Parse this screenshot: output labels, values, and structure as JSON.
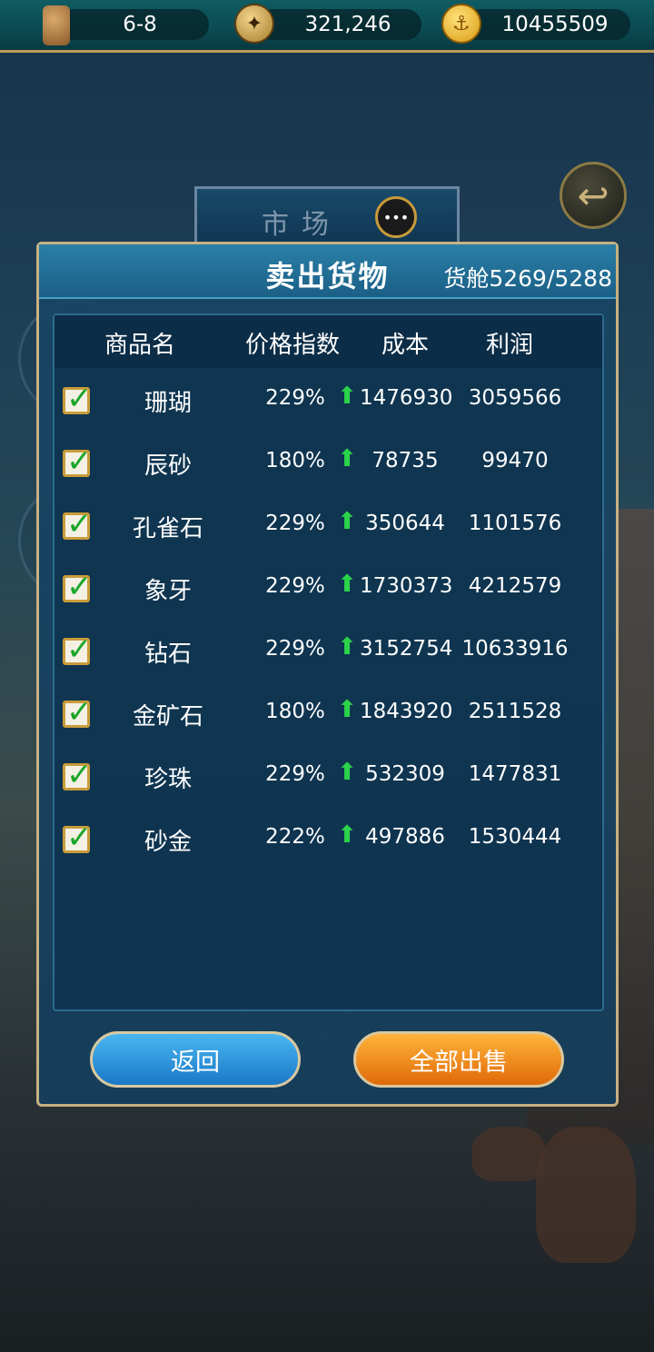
{
  "topbar": {
    "date": "6-8",
    "compass_value": "321,246",
    "gold": "10455509"
  },
  "market_tab": {
    "label": "市场"
  },
  "dialog": {
    "title": "卖出货物",
    "cargo": "货舱5269/5288",
    "columns": [
      "商品名",
      "价格指数",
      "成本",
      "利润"
    ],
    "rows": [
      {
        "name": "珊瑚",
        "pct": "229%",
        "cost": "1476930",
        "profit": "3059566",
        "checked": true
      },
      {
        "name": "辰砂",
        "pct": "180%",
        "cost": "78735",
        "profit": "99470",
        "checked": true
      },
      {
        "name": "孔雀石",
        "pct": "229%",
        "cost": "350644",
        "profit": "1101576",
        "checked": true
      },
      {
        "name": "象牙",
        "pct": "229%",
        "cost": "1730373",
        "profit": "4212579",
        "checked": true
      },
      {
        "name": "钻石",
        "pct": "229%",
        "cost": "3152754",
        "profit": "10633916",
        "checked": true
      },
      {
        "name": "金矿石",
        "pct": "180%",
        "cost": "1843920",
        "profit": "2511528",
        "checked": true
      },
      {
        "name": "珍珠",
        "pct": "229%",
        "cost": "532309",
        "profit": "1477831",
        "checked": true
      },
      {
        "name": "砂金",
        "pct": "222%",
        "cost": "497886",
        "profit": "1530444",
        "checked": true
      }
    ],
    "back_label": "返回",
    "sell_all_label": "全部出售"
  },
  "colors": {
    "accent_gold": "#c7b182",
    "up_arrow": "#2bd34a",
    "sell_orange": "#e06a08",
    "back_blue": "#1a78c8"
  }
}
